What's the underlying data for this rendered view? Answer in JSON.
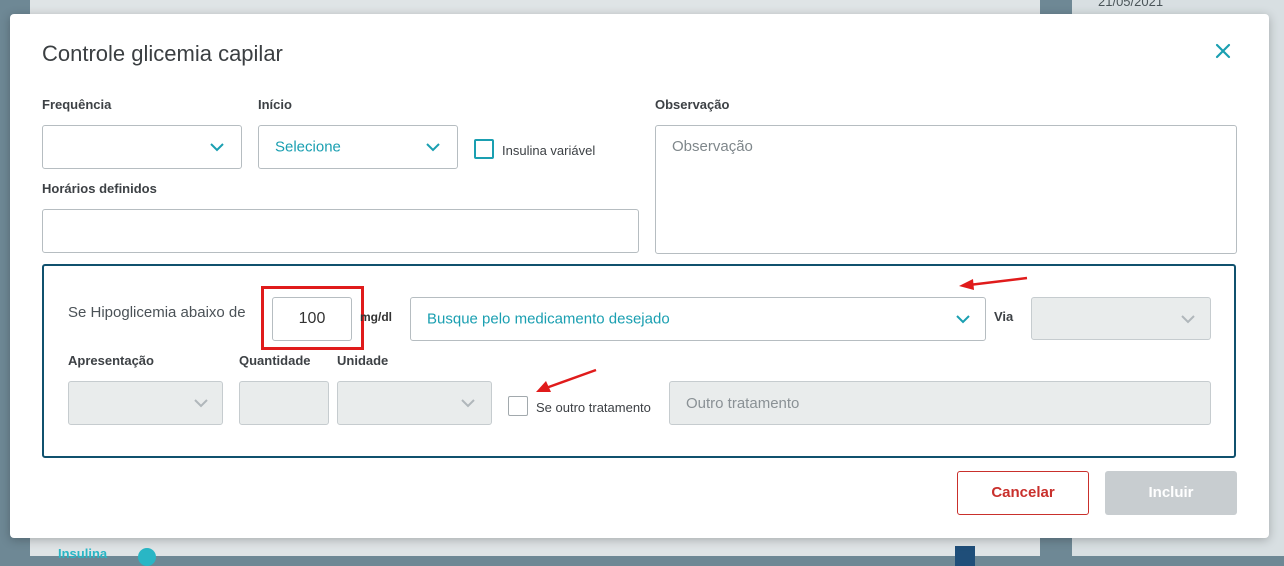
{
  "background": {
    "date_text": "21/05/2021",
    "bottom_tab_label": "Insulina"
  },
  "modal": {
    "title": "Controle glicemia capilar",
    "close_icon": "close-icon"
  },
  "form": {
    "frequency_label": "Frequência",
    "frequency_value": "",
    "start_label": "Início",
    "start_value": "Selecione",
    "variable_insulin_label": "Insulina variável",
    "variable_insulin_checked": false,
    "times_label": "Horários definidos",
    "times_value": "",
    "observation_label": "Observação",
    "observation_placeholder": "Observação"
  },
  "hypoglycemia": {
    "threshold_label": "Se Hipoglicemia abaixo de",
    "threshold_value": "100",
    "unit_label": "mg/dl",
    "medication_placeholder": "Busque pelo medicamento desejado",
    "route_label": "Via",
    "presentation_label": "Apresentação",
    "quantity_label": "Quantidade",
    "unit_field_label": "Unidade",
    "other_treatment_checkbox_label": "Se outro tratamento",
    "other_treatment_checked": false,
    "other_treatment_placeholder": "Outro tratamento"
  },
  "buttons": {
    "cancel_label": "Cancelar",
    "include_label": "Incluir"
  },
  "colors": {
    "accent": "#1a9fb1",
    "annotation_red": "#e01b1b",
    "section_border": "#10516e",
    "cancel_red": "#c9302c"
  }
}
